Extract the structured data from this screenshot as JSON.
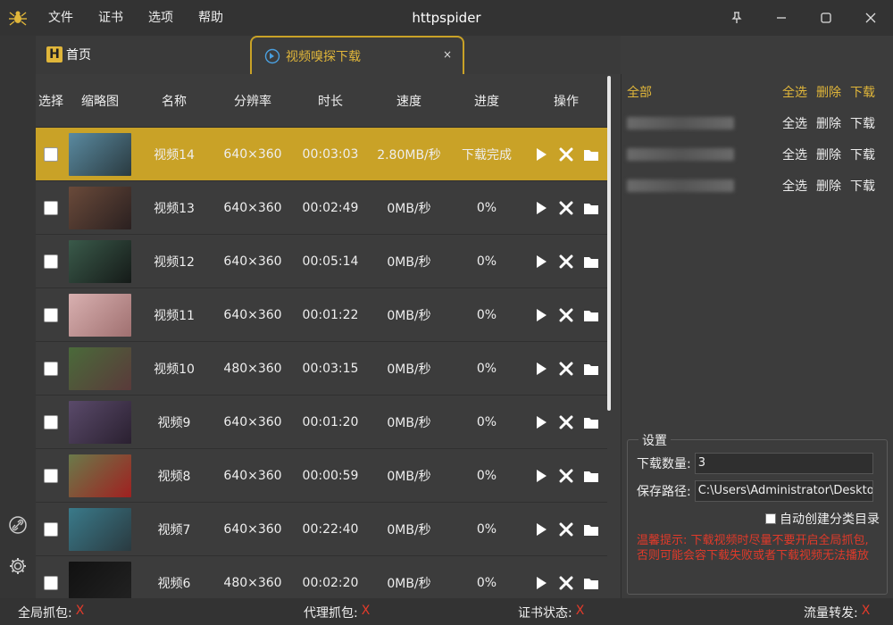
{
  "window": {
    "title": "httpspider"
  },
  "menu": [
    "文件",
    "证书",
    "选项",
    "帮助"
  ],
  "tabs": {
    "home": "首页",
    "active": "视频嗅探下载",
    "close": "×"
  },
  "colors": {
    "accent": "#c9a227",
    "accent_text": "#e0b63a",
    "error": "#e53a2a",
    "bg": "#3c3c3c"
  },
  "table": {
    "headers": [
      "选择",
      "缩略图",
      "名称",
      "分辨率",
      "时长",
      "速度",
      "进度",
      "操作"
    ],
    "rows": [
      {
        "name": "视频14",
        "res": "640×360",
        "dur": "00:03:03",
        "speed": "2.80MB/秒",
        "progress": "下载完成",
        "selected": true
      },
      {
        "name": "视频13",
        "res": "640×360",
        "dur": "00:02:49",
        "speed": "0MB/秒",
        "progress": "0%",
        "selected": false
      },
      {
        "name": "视频12",
        "res": "640×360",
        "dur": "00:05:14",
        "speed": "0MB/秒",
        "progress": "0%",
        "selected": false
      },
      {
        "name": "视频11",
        "res": "640×360",
        "dur": "00:01:22",
        "speed": "0MB/秒",
        "progress": "0%",
        "selected": false
      },
      {
        "name": "视频10",
        "res": "480×360",
        "dur": "00:03:15",
        "speed": "0MB/秒",
        "progress": "0%",
        "selected": false
      },
      {
        "name": "视频9",
        "res": "640×360",
        "dur": "00:01:20",
        "speed": "0MB/秒",
        "progress": "0%",
        "selected": false
      },
      {
        "name": "视频8",
        "res": "640×360",
        "dur": "00:00:59",
        "speed": "0MB/秒",
        "progress": "0%",
        "selected": false
      },
      {
        "name": "视频7",
        "res": "640×360",
        "dur": "00:22:40",
        "speed": "0MB/秒",
        "progress": "0%",
        "selected": false
      },
      {
        "name": "视频6",
        "res": "480×360",
        "dur": "00:02:20",
        "speed": "0MB/秒",
        "progress": "0%",
        "selected": false
      }
    ]
  },
  "right": {
    "all_label": "全部",
    "select_all": "全选",
    "delete": "删除",
    "download": "下载"
  },
  "settings": {
    "title": "设置",
    "count_label": "下载数量:",
    "count_value": "3",
    "path_label": "保存路径:",
    "path_value": "C:\\Users\\Administrator\\Desktop\\视",
    "auto_label": "自动创建分类目录",
    "warning": "温馨提示: 下载视频时尽量不要开启全局抓包, 否则可能会容下载失败或者下载视频无法播放"
  },
  "status": [
    {
      "label": "全局抓包:",
      "value": "X"
    },
    {
      "label": "代理抓包:",
      "value": "X"
    },
    {
      "label": "证书状态:",
      "value": "X"
    },
    {
      "label": "流量转发:",
      "value": "X"
    }
  ]
}
